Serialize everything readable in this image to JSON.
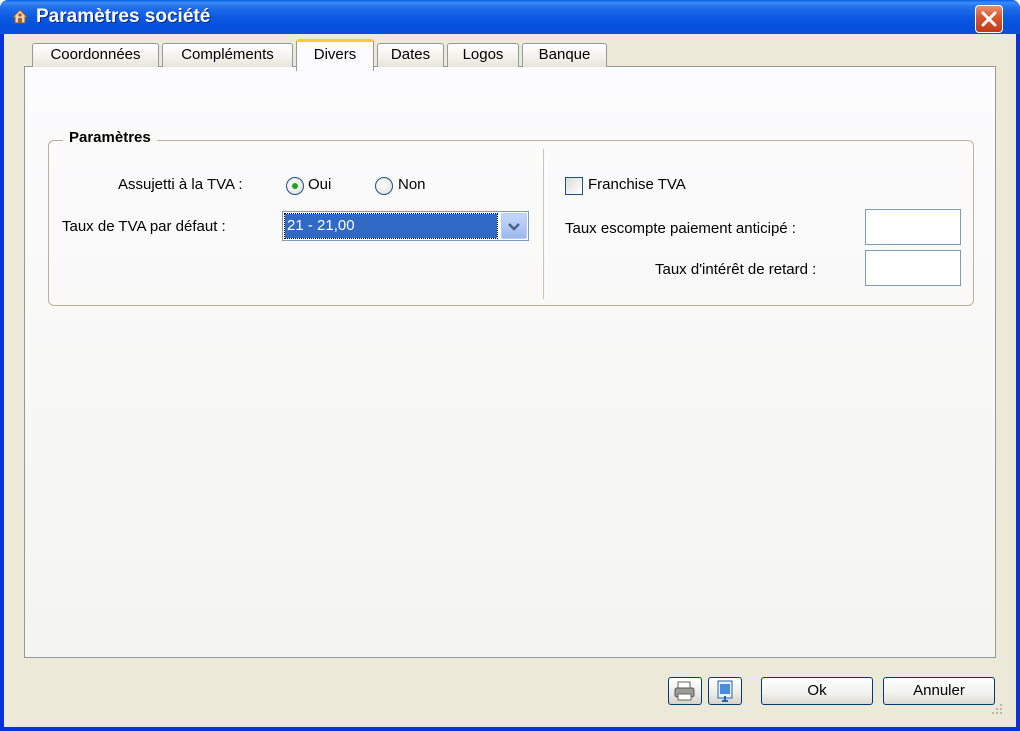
{
  "window": {
    "title": "Paramètres société",
    "accent_color": "#0a58e0",
    "close_icon": "close-icon"
  },
  "tabs": [
    {
      "label": "Coordonnées",
      "active": false
    },
    {
      "label": "Compléments",
      "active": false
    },
    {
      "label": "Divers",
      "active": true
    },
    {
      "label": "Dates",
      "active": false
    },
    {
      "label": "Logos",
      "active": false
    },
    {
      "label": "Banque",
      "active": false
    }
  ],
  "group": {
    "title": "Paramètres",
    "tva_label": "Assujetti à la TVA :",
    "radio_oui": "Oui",
    "radio_non": "Non",
    "selected_radio": "Oui",
    "default_rate_label": "Taux de TVA par défaut :",
    "default_rate_value": "21 - 21,00",
    "franchise_label": "Franchise TVA",
    "franchise_checked": false,
    "discount_label": "Taux escompte paiement anticipé :",
    "discount_value": "",
    "interest_label": "Taux d'intérêt de retard :",
    "interest_value": ""
  },
  "footer": {
    "print_icon": "printer-icon",
    "preview_icon": "preview-icon",
    "ok_label": "Ok",
    "cancel_label": "Annuler"
  }
}
